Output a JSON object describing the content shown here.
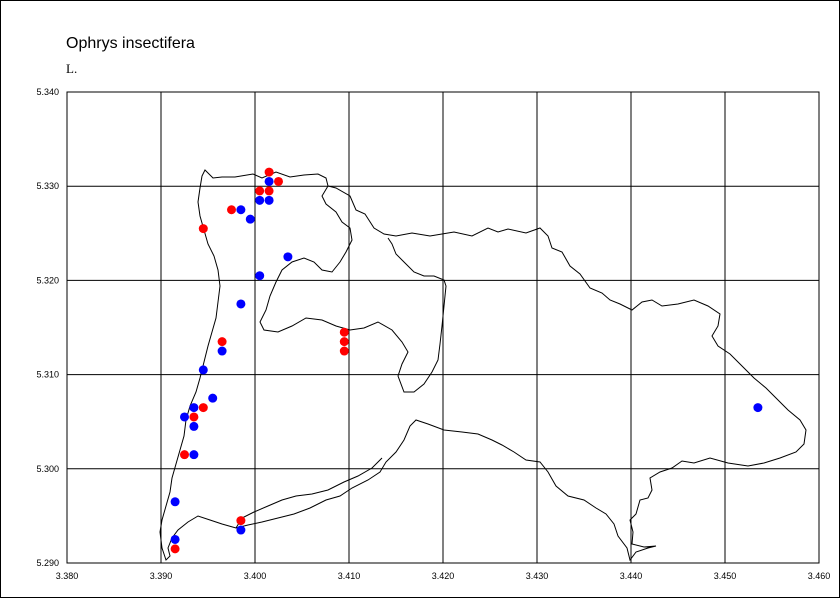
{
  "title": "Ophrys insectifera",
  "author": "L.",
  "chart_data": {
    "type": "scatter",
    "title": "Ophrys insectifera",
    "subtitle": "L.",
    "xlim": [
      3.38,
      3.46
    ],
    "ylim": [
      5.29,
      5.34
    ],
    "x_ticks": [
      "3.380",
      "3.390",
      "3.400",
      "3.410",
      "3.420",
      "3.430",
      "3.440",
      "3.450",
      "3.460"
    ],
    "y_ticks": [
      "5.340",
      "5.330",
      "5.320",
      "5.310",
      "5.300",
      "5.290"
    ],
    "grid": true,
    "colors": {
      "red": "#ff0000",
      "blue": "#0000ff"
    },
    "series": [
      {
        "color": "#ff0000",
        "points": [
          [
            3.4015,
            5.3315
          ],
          [
            3.4005,
            5.3295
          ],
          [
            3.4015,
            5.3295
          ],
          [
            3.4025,
            5.3305
          ],
          [
            3.3975,
            5.3275
          ],
          [
            3.3945,
            5.3255
          ],
          [
            3.4095,
            5.3145
          ],
          [
            3.4095,
            5.3135
          ],
          [
            3.4095,
            5.3125
          ],
          [
            3.3965,
            5.3135
          ],
          [
            3.3935,
            5.3055
          ],
          [
            3.3945,
            5.3065
          ],
          [
            3.3925,
            5.3015
          ],
          [
            3.3985,
            5.2945
          ],
          [
            3.3915,
            5.2915
          ]
        ]
      },
      {
        "color": "#0000ff",
        "points": [
          [
            3.4015,
            5.3305
          ],
          [
            3.4005,
            5.3285
          ],
          [
            3.4015,
            5.3285
          ],
          [
            3.3985,
            5.3275
          ],
          [
            3.3995,
            5.3265
          ],
          [
            3.4035,
            5.3225
          ],
          [
            3.4005,
            5.3205
          ],
          [
            3.3985,
            5.3175
          ],
          [
            3.3965,
            5.3125
          ],
          [
            3.3945,
            5.3105
          ],
          [
            3.3955,
            5.3075
          ],
          [
            3.3935,
            5.3065
          ],
          [
            3.3925,
            5.3055
          ],
          [
            3.3935,
            5.3045
          ],
          [
            3.3935,
            5.3015
          ],
          [
            3.3915,
            5.2965
          ],
          [
            3.3915,
            5.2925
          ],
          [
            3.3985,
            5.2935
          ],
          [
            3.4535,
            5.3065
          ]
        ]
      }
    ]
  }
}
